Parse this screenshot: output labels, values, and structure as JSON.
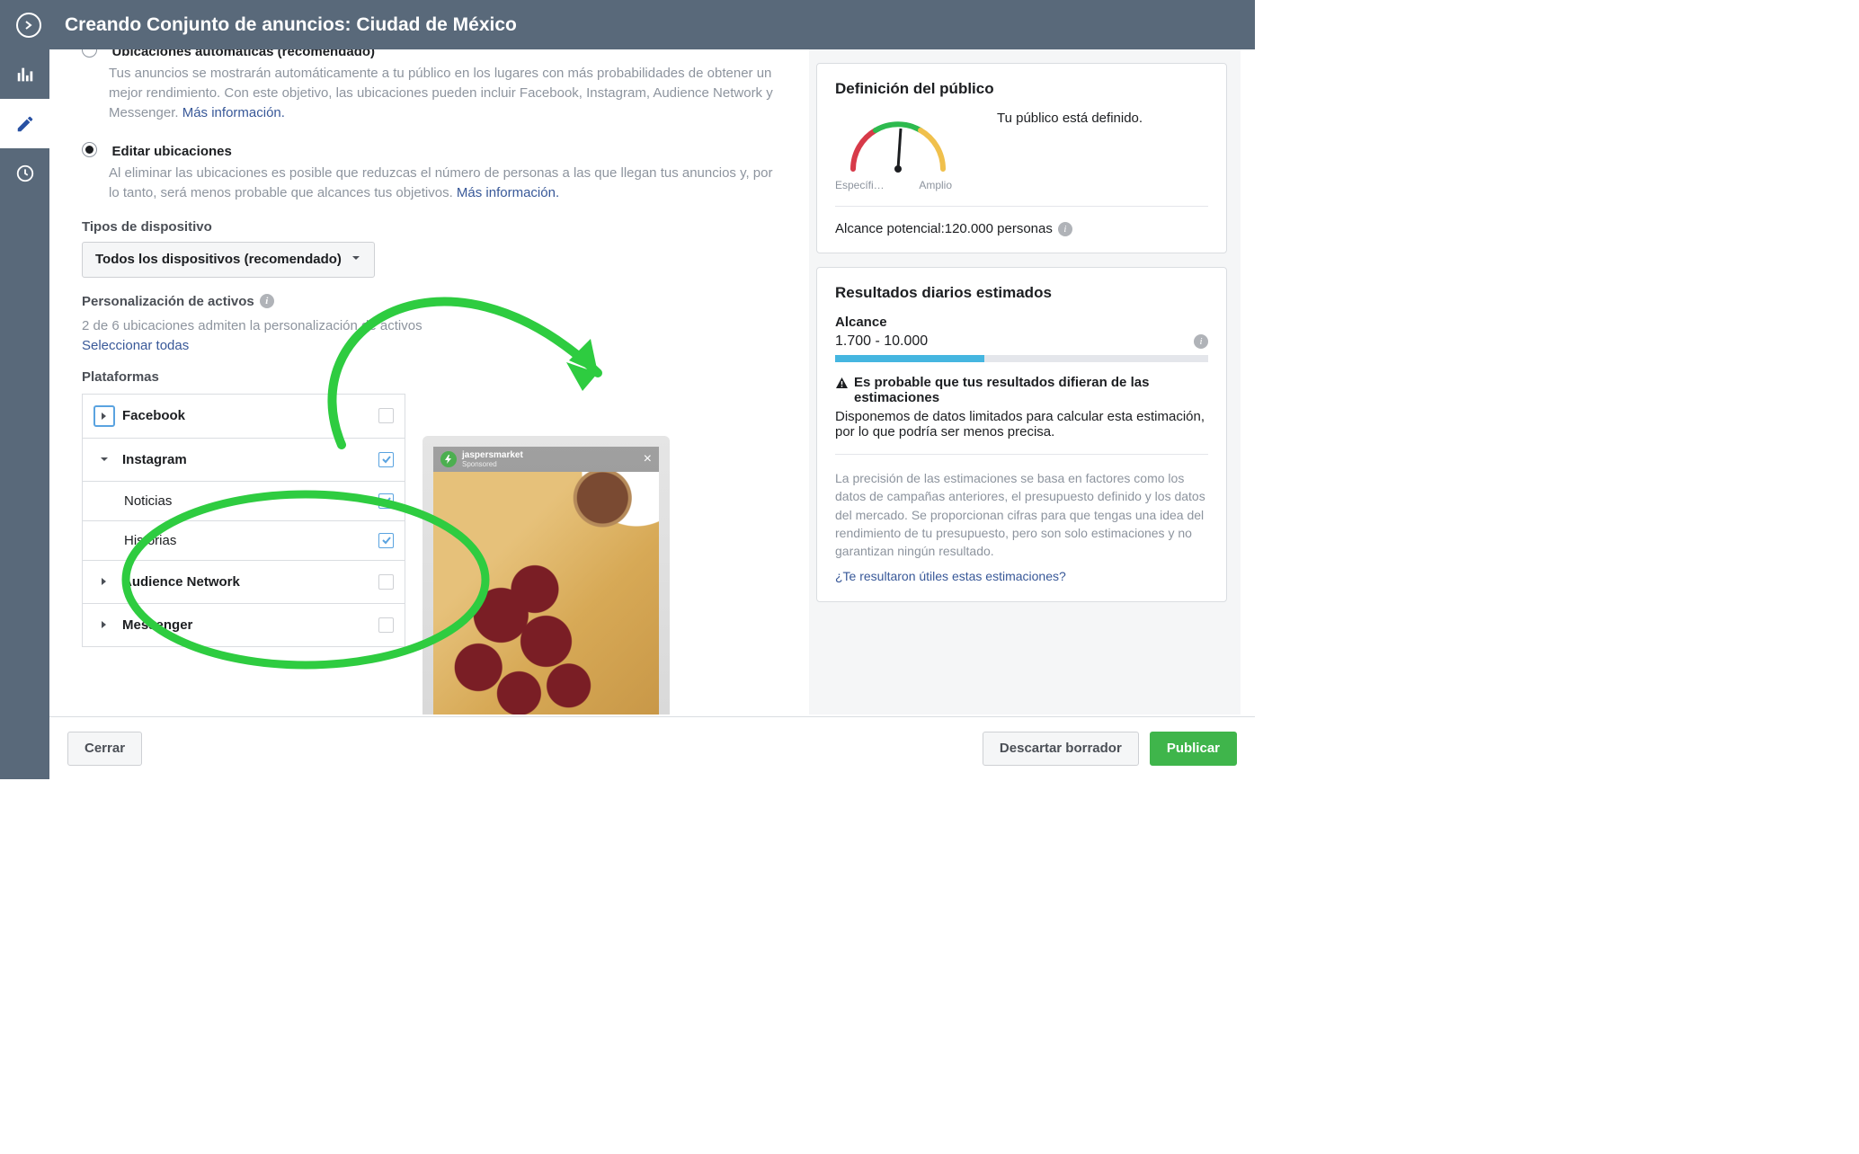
{
  "header": {
    "title": "Creando Conjunto de anuncios: Ciudad de México"
  },
  "placements": {
    "auto_title": "Ubicaciones automáticas (recomendado)",
    "auto_desc": "Tus anuncios se mostrarán automáticamente a tu público en los lugares con más probabilidades de obtener un mejor rendimiento. Con este objetivo, las ubicaciones pueden incluir Facebook, Instagram, Audience Network y Messenger.",
    "learn_more": "Más información.",
    "edit_title": "Editar ubicaciones",
    "edit_desc": "Al eliminar las ubicaciones es posible que reduzcas el número de personas a las que llegan tus anuncios y, por lo tanto, será menos probable que alcances tus objetivos.",
    "device_label": "Tipos de dispositivo",
    "device_value": "Todos los dispositivos (recomendado)",
    "asset_custom_label": "Personalización de activos",
    "asset_custom_desc": "2 de 6 ubicaciones admiten la personalización de activos",
    "select_all": "Seleccionar todas",
    "platforms_label": "Plataformas",
    "platforms": {
      "facebook": "Facebook",
      "instagram": "Instagram",
      "instagram_feed": "Noticias",
      "instagram_stories": "Historias",
      "audience_network": "Audience Network",
      "messenger": "Messenger"
    }
  },
  "preview": {
    "account": "jaspersmarket",
    "sponsored": "Sponsored"
  },
  "audience": {
    "title": "Definición del público",
    "gauge_left": "Específi…",
    "gauge_right": "Amplio",
    "status": "Tu público está definido.",
    "reach_text_prefix": "Alcance potencial: ",
    "reach_value": "120.000 personas"
  },
  "results": {
    "title": "Resultados diarios estimados",
    "reach_label": "Alcance",
    "reach_range": "1.700 - 10.000",
    "warn_title": "Es probable que tus resultados difieran de las estimaciones",
    "warn_desc": "Disponemos de datos limitados para calcular esta estimación, por lo que podría ser menos precisa.",
    "precision": "La precisión de las estimaciones se basa en factores como los datos de campañas anteriores, el presupuesto definido y los datos del mercado. Se proporcionan cifras para que tengas una idea del rendimiento de tu presupuesto, pero son solo estimaciones y no garantizan ningún resultado.",
    "feedback": "¿Te resultaron útiles estas estimaciones?"
  },
  "footer": {
    "close": "Cerrar",
    "discard": "Descartar borrador",
    "publish": "Publicar"
  }
}
